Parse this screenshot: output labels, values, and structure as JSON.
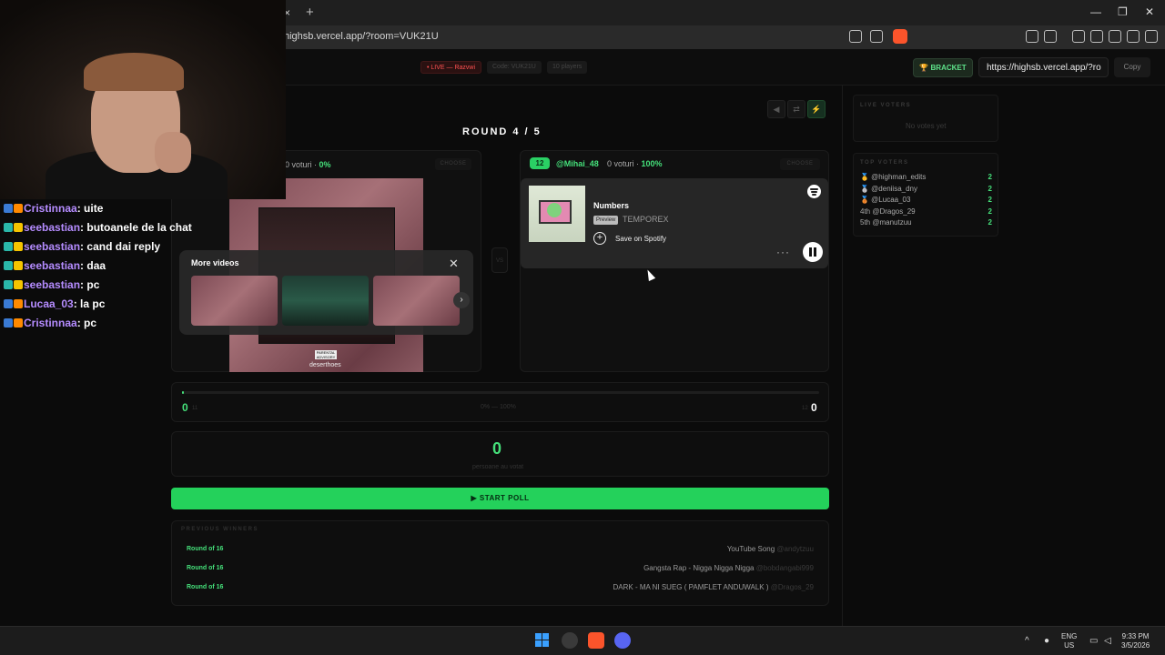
{
  "browser": {
    "url": "highsb.vercel.app/?room=VUK21U",
    "tab_close": "×",
    "tab_new": "+",
    "win_min": "—",
    "win_max": "❐",
    "win_close": "✕"
  },
  "header": {
    "live_pill": "• LIVE — Razvwi",
    "code_pill": "Code: VUK21U",
    "players_pill": "10 players",
    "bracket_label": "🏆 BRACKET",
    "share_url": "https://highsb.vercel.app/?ro",
    "copy_label": "Copy"
  },
  "chat": [
    {
      "user": "Cristinnaa",
      "msg": "uite",
      "badge_colors": [
        "#3a7bd5",
        "#ff8a00"
      ]
    },
    {
      "user": "seebastian",
      "msg": "butoanele de la chat",
      "badge_colors": [
        "#2ab7a9",
        "#f5c400"
      ]
    },
    {
      "user": "seebastian",
      "msg": "cand dai reply",
      "badge_colors": [
        "#2ab7a9",
        "#f5c400"
      ]
    },
    {
      "user": "seebastian",
      "msg": "daa",
      "badge_colors": [
        "#2ab7a9",
        "#f5c400"
      ]
    },
    {
      "user": "seebastian",
      "msg": "pc",
      "badge_colors": [
        "#2ab7a9",
        "#f5c400"
      ]
    },
    {
      "user": "Lucaa_03",
      "msg": "la pc",
      "badge_colors": [
        "#3a7bd5",
        "#ff8a00"
      ]
    },
    {
      "user": "Cristinnaa",
      "msg": "pc",
      "badge_colors": [
        "#3a7bd5",
        "#ff8a00"
      ]
    }
  ],
  "controls": {
    "prev": "◀",
    "shuffle": "⇄",
    "power": "⚡"
  },
  "round": {
    "title": "ROUND 4 / 5"
  },
  "left": {
    "votes_text": "0 voturi · ",
    "votes_pct": "0%",
    "choose": "CHOOSE",
    "pa_label": "PARENTAL ADVISORY",
    "cover_text": "deserthoes",
    "more_videos_title": "More videos",
    "more_videos_close": "✕",
    "more_videos_next": "›"
  },
  "mid": {
    "vs": "VS"
  },
  "right": {
    "number": "12",
    "user": "@Mihai_48",
    "votes_text": "0 voturi · ",
    "votes_pct": "100%",
    "choose": "CHOOSE",
    "song_title": "Numbers",
    "preview_label": "Preview",
    "artist": "TEMPOREX",
    "save_label": "Save on Spotify",
    "more_label": "···"
  },
  "progress": {
    "left_score": "0",
    "left_sub": "11",
    "mid_label": "0% — 100%",
    "right_sub": "12",
    "right_score": "0",
    "fill_fraction": 0.003
  },
  "voters": {
    "count": "0",
    "label": "persoane au votat"
  },
  "start_button": "▶ START POLL",
  "winners": {
    "title": "PREVIOUS WINNERS",
    "rows": [
      {
        "round": "Round of 16",
        "song": "YouTube Song",
        "by": "@andytzuu"
      },
      {
        "round": "Round of 16",
        "song": "Gangsta Rap - Nigga Nigga Nigga",
        "by": "@bobdangabi999"
      },
      {
        "round": "Round of 16",
        "song": "DARK - MA NI SUEG ( PAMFLET ANDUWALK )",
        "by": "@Dragos_29"
      }
    ]
  },
  "sidebar": {
    "live_title": "LIVE VOTERS",
    "no_votes": "No votes yet",
    "top_title": "TOP VOTERS",
    "top_voters": [
      {
        "name": "🥇 @highman_edits",
        "count": "2"
      },
      {
        "name": "🥈 @deniisa_dny",
        "count": "2"
      },
      {
        "name": "🥉 @Lucaa_03",
        "count": "2"
      },
      {
        "name": "4th @Dragos_29",
        "count": "2"
      },
      {
        "name": "5th @manutzuu",
        "count": "2"
      }
    ]
  },
  "taskbar": {
    "lang_top": "ENG",
    "lang_bottom": "US",
    "time": "9:33 PM",
    "date": "3/5/2026"
  }
}
